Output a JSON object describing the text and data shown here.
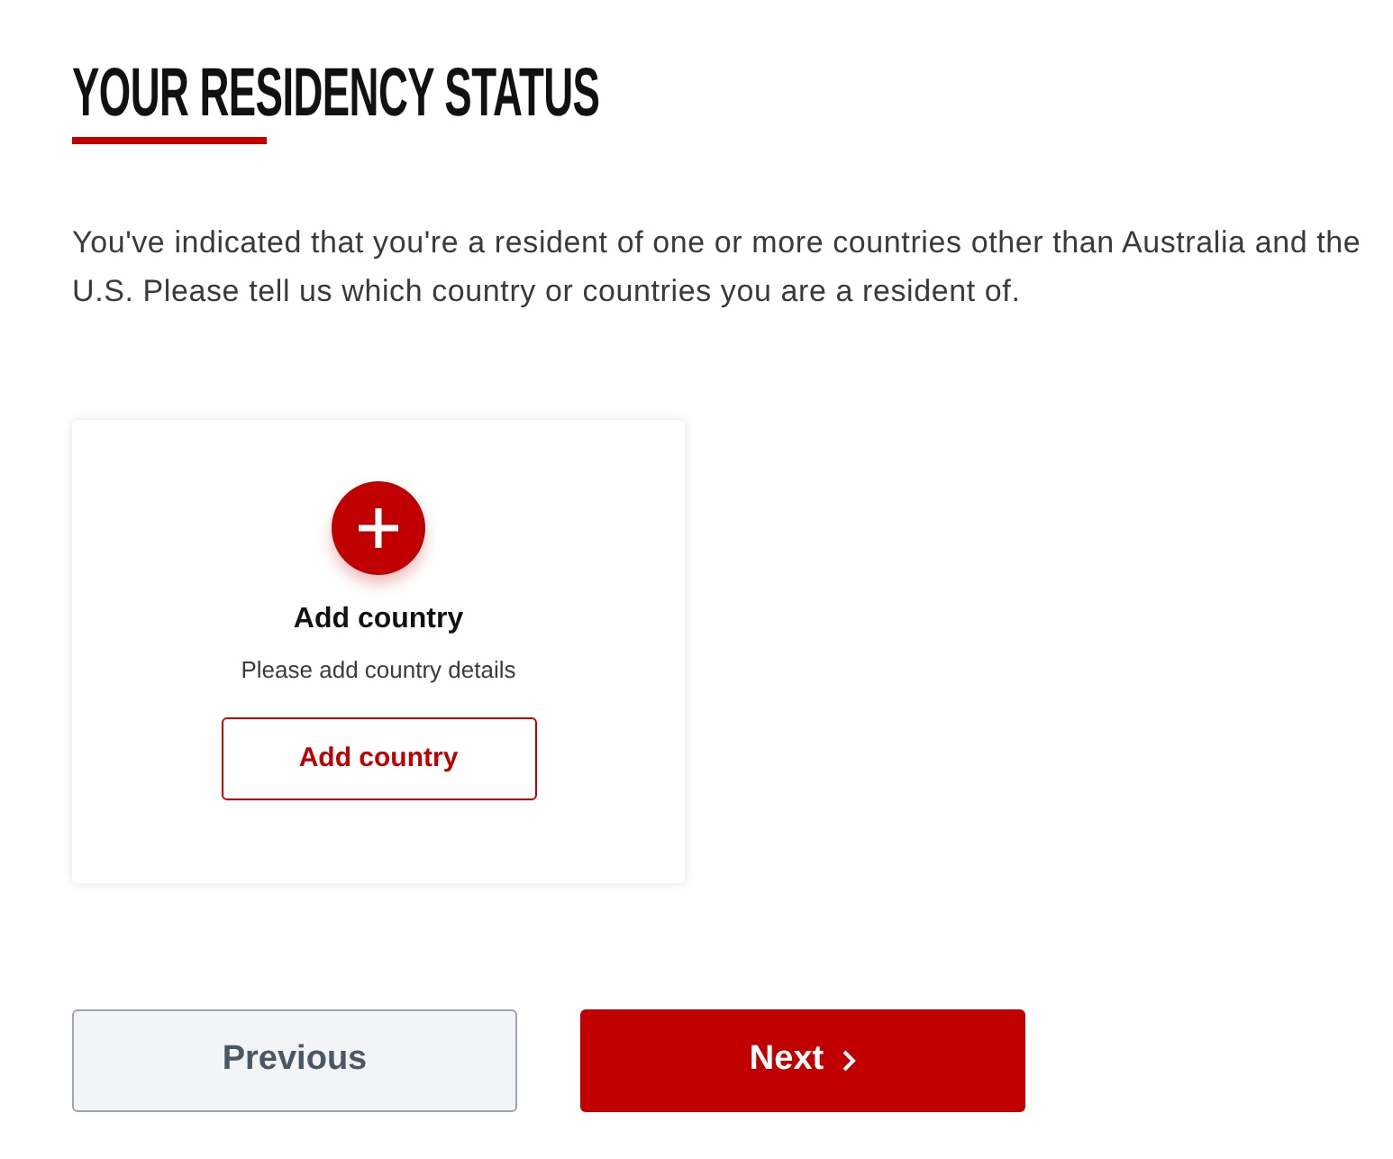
{
  "page": {
    "title": "YOUR RESIDENCY STATUS",
    "intro": "You've indicated that you're a resident of one or more countries other than Australia and the U.S. Please tell us which country or countries you are a resident of."
  },
  "country_card": {
    "title": "Add country",
    "subtitle": "Please add country details",
    "button": "Add country"
  },
  "navigation": {
    "previous": "Previous",
    "next": "Next"
  }
}
